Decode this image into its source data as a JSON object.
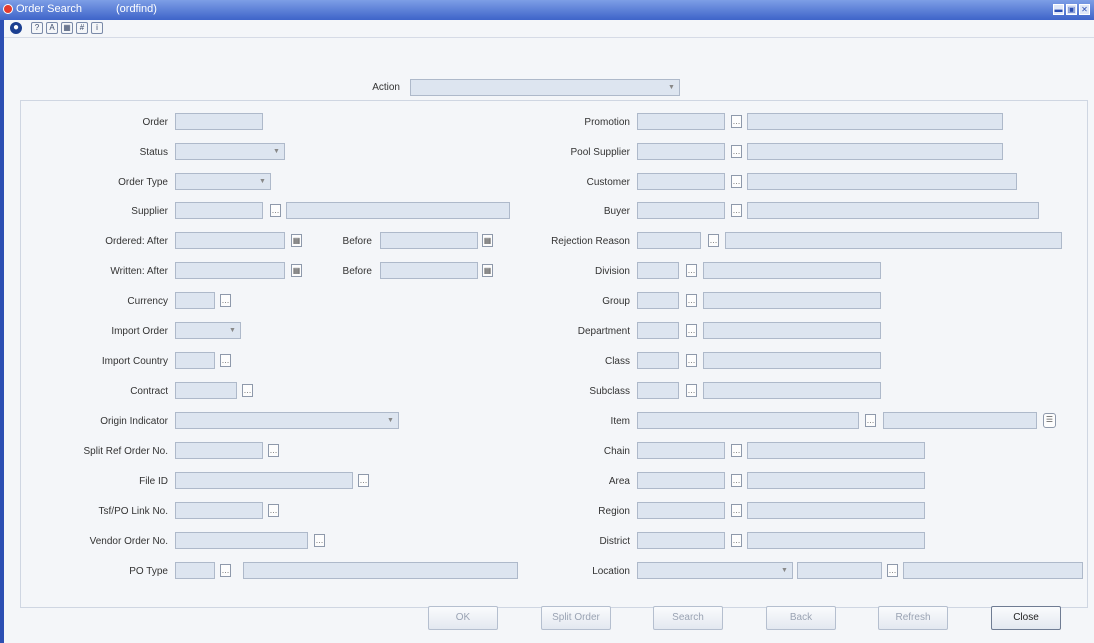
{
  "window": {
    "title": "Order Search",
    "module": "(ordfind)"
  },
  "window_buttons": [
    "▬",
    "▣",
    "✕"
  ],
  "toolbar": {
    "icons": [
      "globe-icon",
      "help-icon",
      "spell-check-icon",
      "calendar-icon",
      "calculator-icon",
      "info-icon"
    ]
  },
  "action": {
    "label": "Action",
    "value": ""
  },
  "left": {
    "order": "Order",
    "status": "Status",
    "order_type": "Order Type",
    "supplier": "Supplier",
    "ordered_after": "Ordered: After",
    "ordered_before": "Before",
    "written_after": "Written: After",
    "written_before": "Before",
    "currency": "Currency",
    "import_order": "Import Order",
    "import_country": "Import Country",
    "contract": "Contract",
    "origin_indicator": "Origin Indicator",
    "split_ref": "Split Ref Order No.",
    "file_id": "File ID",
    "tsf_po_link": "Tsf/PO Link No.",
    "vendor_order": "Vendor Order No.",
    "po_type": "PO Type"
  },
  "right": {
    "promotion": "Promotion",
    "pool_supplier": "Pool Supplier",
    "customer": "Customer",
    "buyer": "Buyer",
    "rejection_reason": "Rejection Reason",
    "division": "Division",
    "group": "Group",
    "department": "Department",
    "class": "Class",
    "subclass": "Subclass",
    "item": "Item",
    "chain": "Chain",
    "area": "Area",
    "region": "Region",
    "district": "District",
    "location": "Location"
  },
  "buttons": {
    "ok": "OK",
    "split_order": "Split Order",
    "search": "Search",
    "back": "Back",
    "refresh": "Refresh",
    "close": "Close"
  }
}
